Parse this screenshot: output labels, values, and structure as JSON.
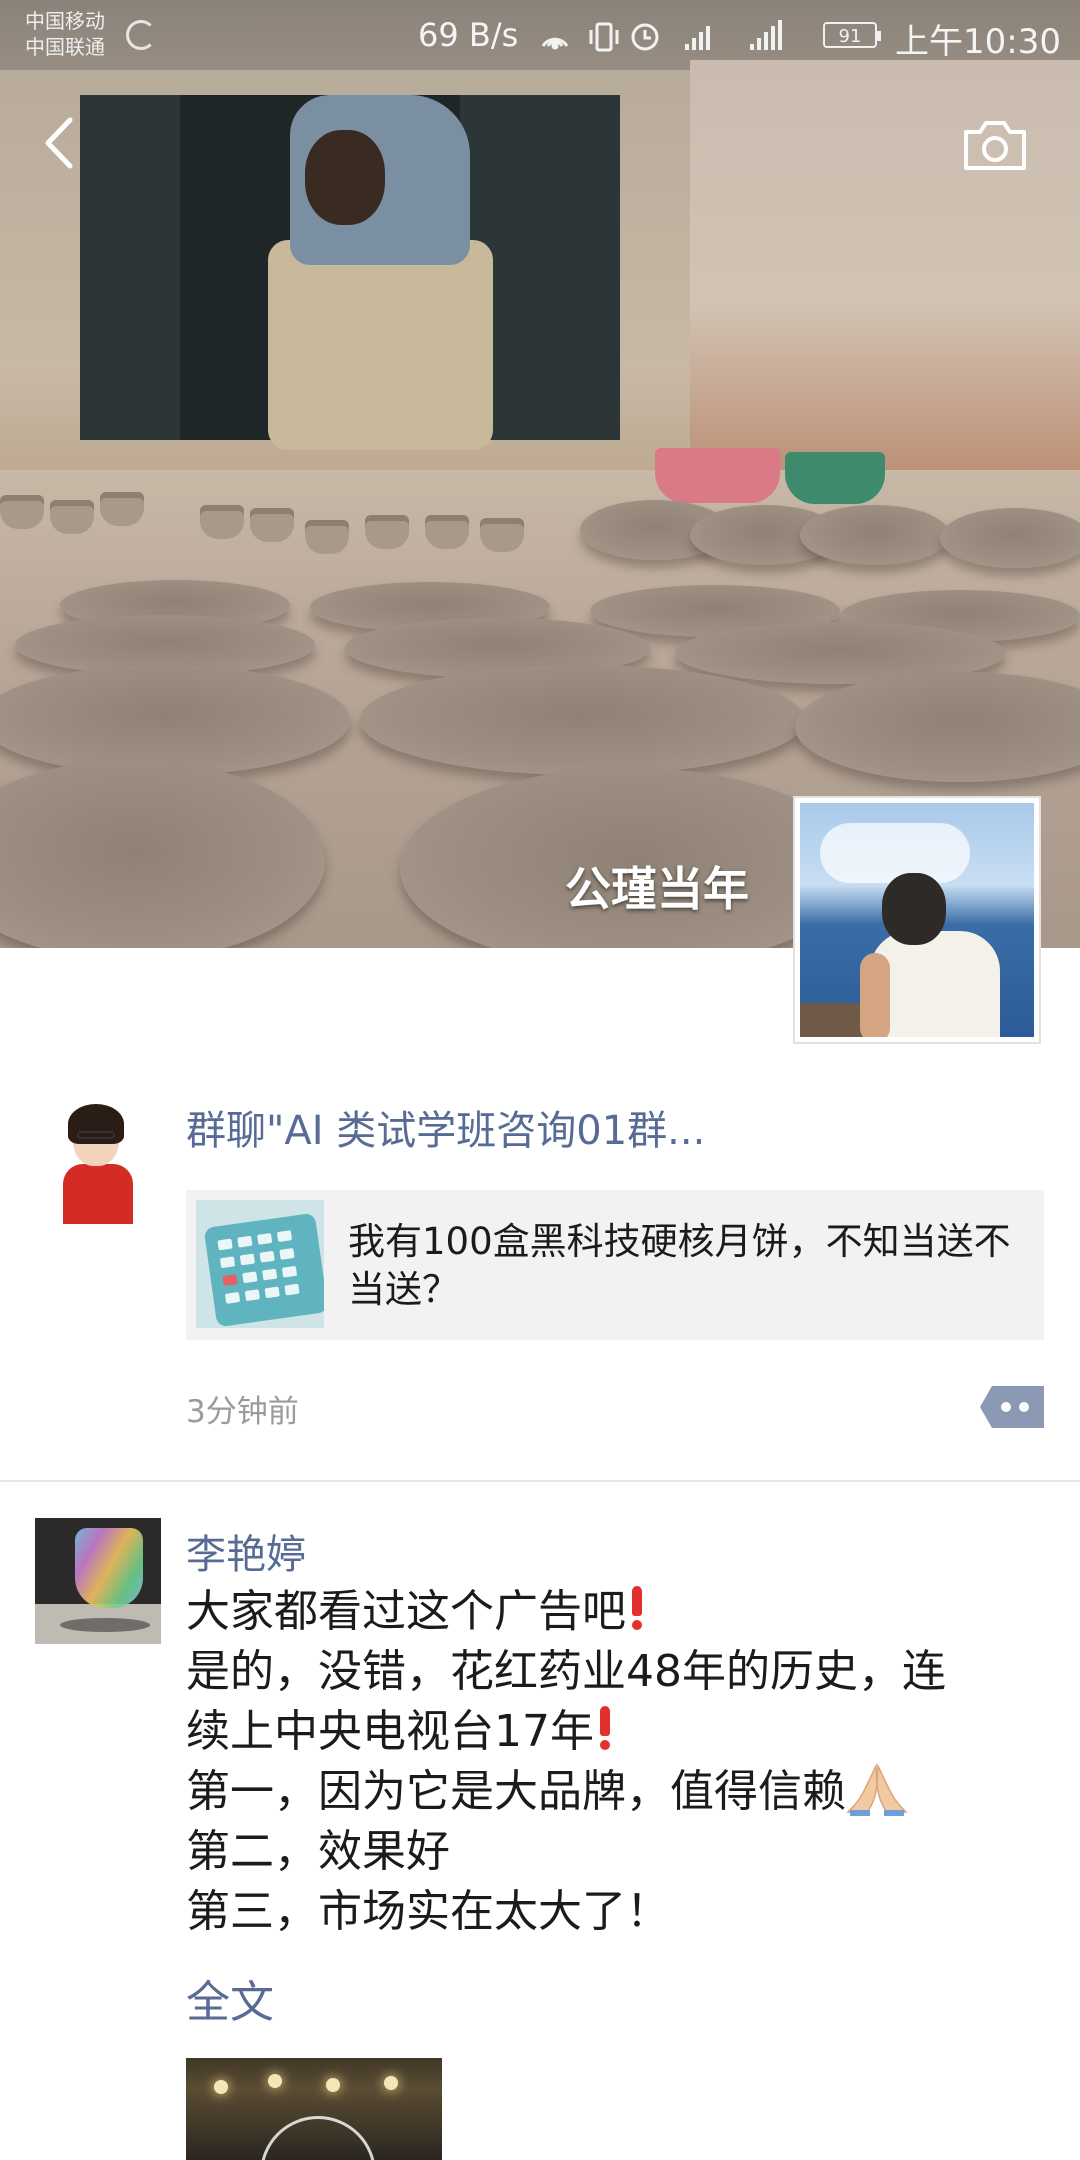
{
  "status_bar": {
    "carrier_1": "中国移动",
    "carrier_2": "中国联通",
    "net_speed": "69 B/s",
    "battery": "91",
    "time": "上午10:30"
  },
  "header": {
    "back_icon": "back-chevron-icon",
    "camera_icon": "camera-icon",
    "username": "公瑾当年"
  },
  "posts": [
    {
      "author": "群聊\"AI 类试学班咨询01群...",
      "share_text": "我有100盒黑科技硬核月饼，不知当送不当送？",
      "time": "3分钟前"
    },
    {
      "author": "李艳婷",
      "lines": [
        "大家都看过这个广告吧",
        "是的，没错，花红药业48年的历史，连",
        "续上中央电视台17年",
        "第一，因为它是大品牌，值得信赖",
        "第二，效果好",
        "第三，市场实在太大了！"
      ],
      "full_text_link": "全文"
    }
  ],
  "colors": {
    "link": "#576b95",
    "text": "#1b1b1b",
    "time": "#9b9b9b",
    "share_bg": "#f2f2f2"
  }
}
